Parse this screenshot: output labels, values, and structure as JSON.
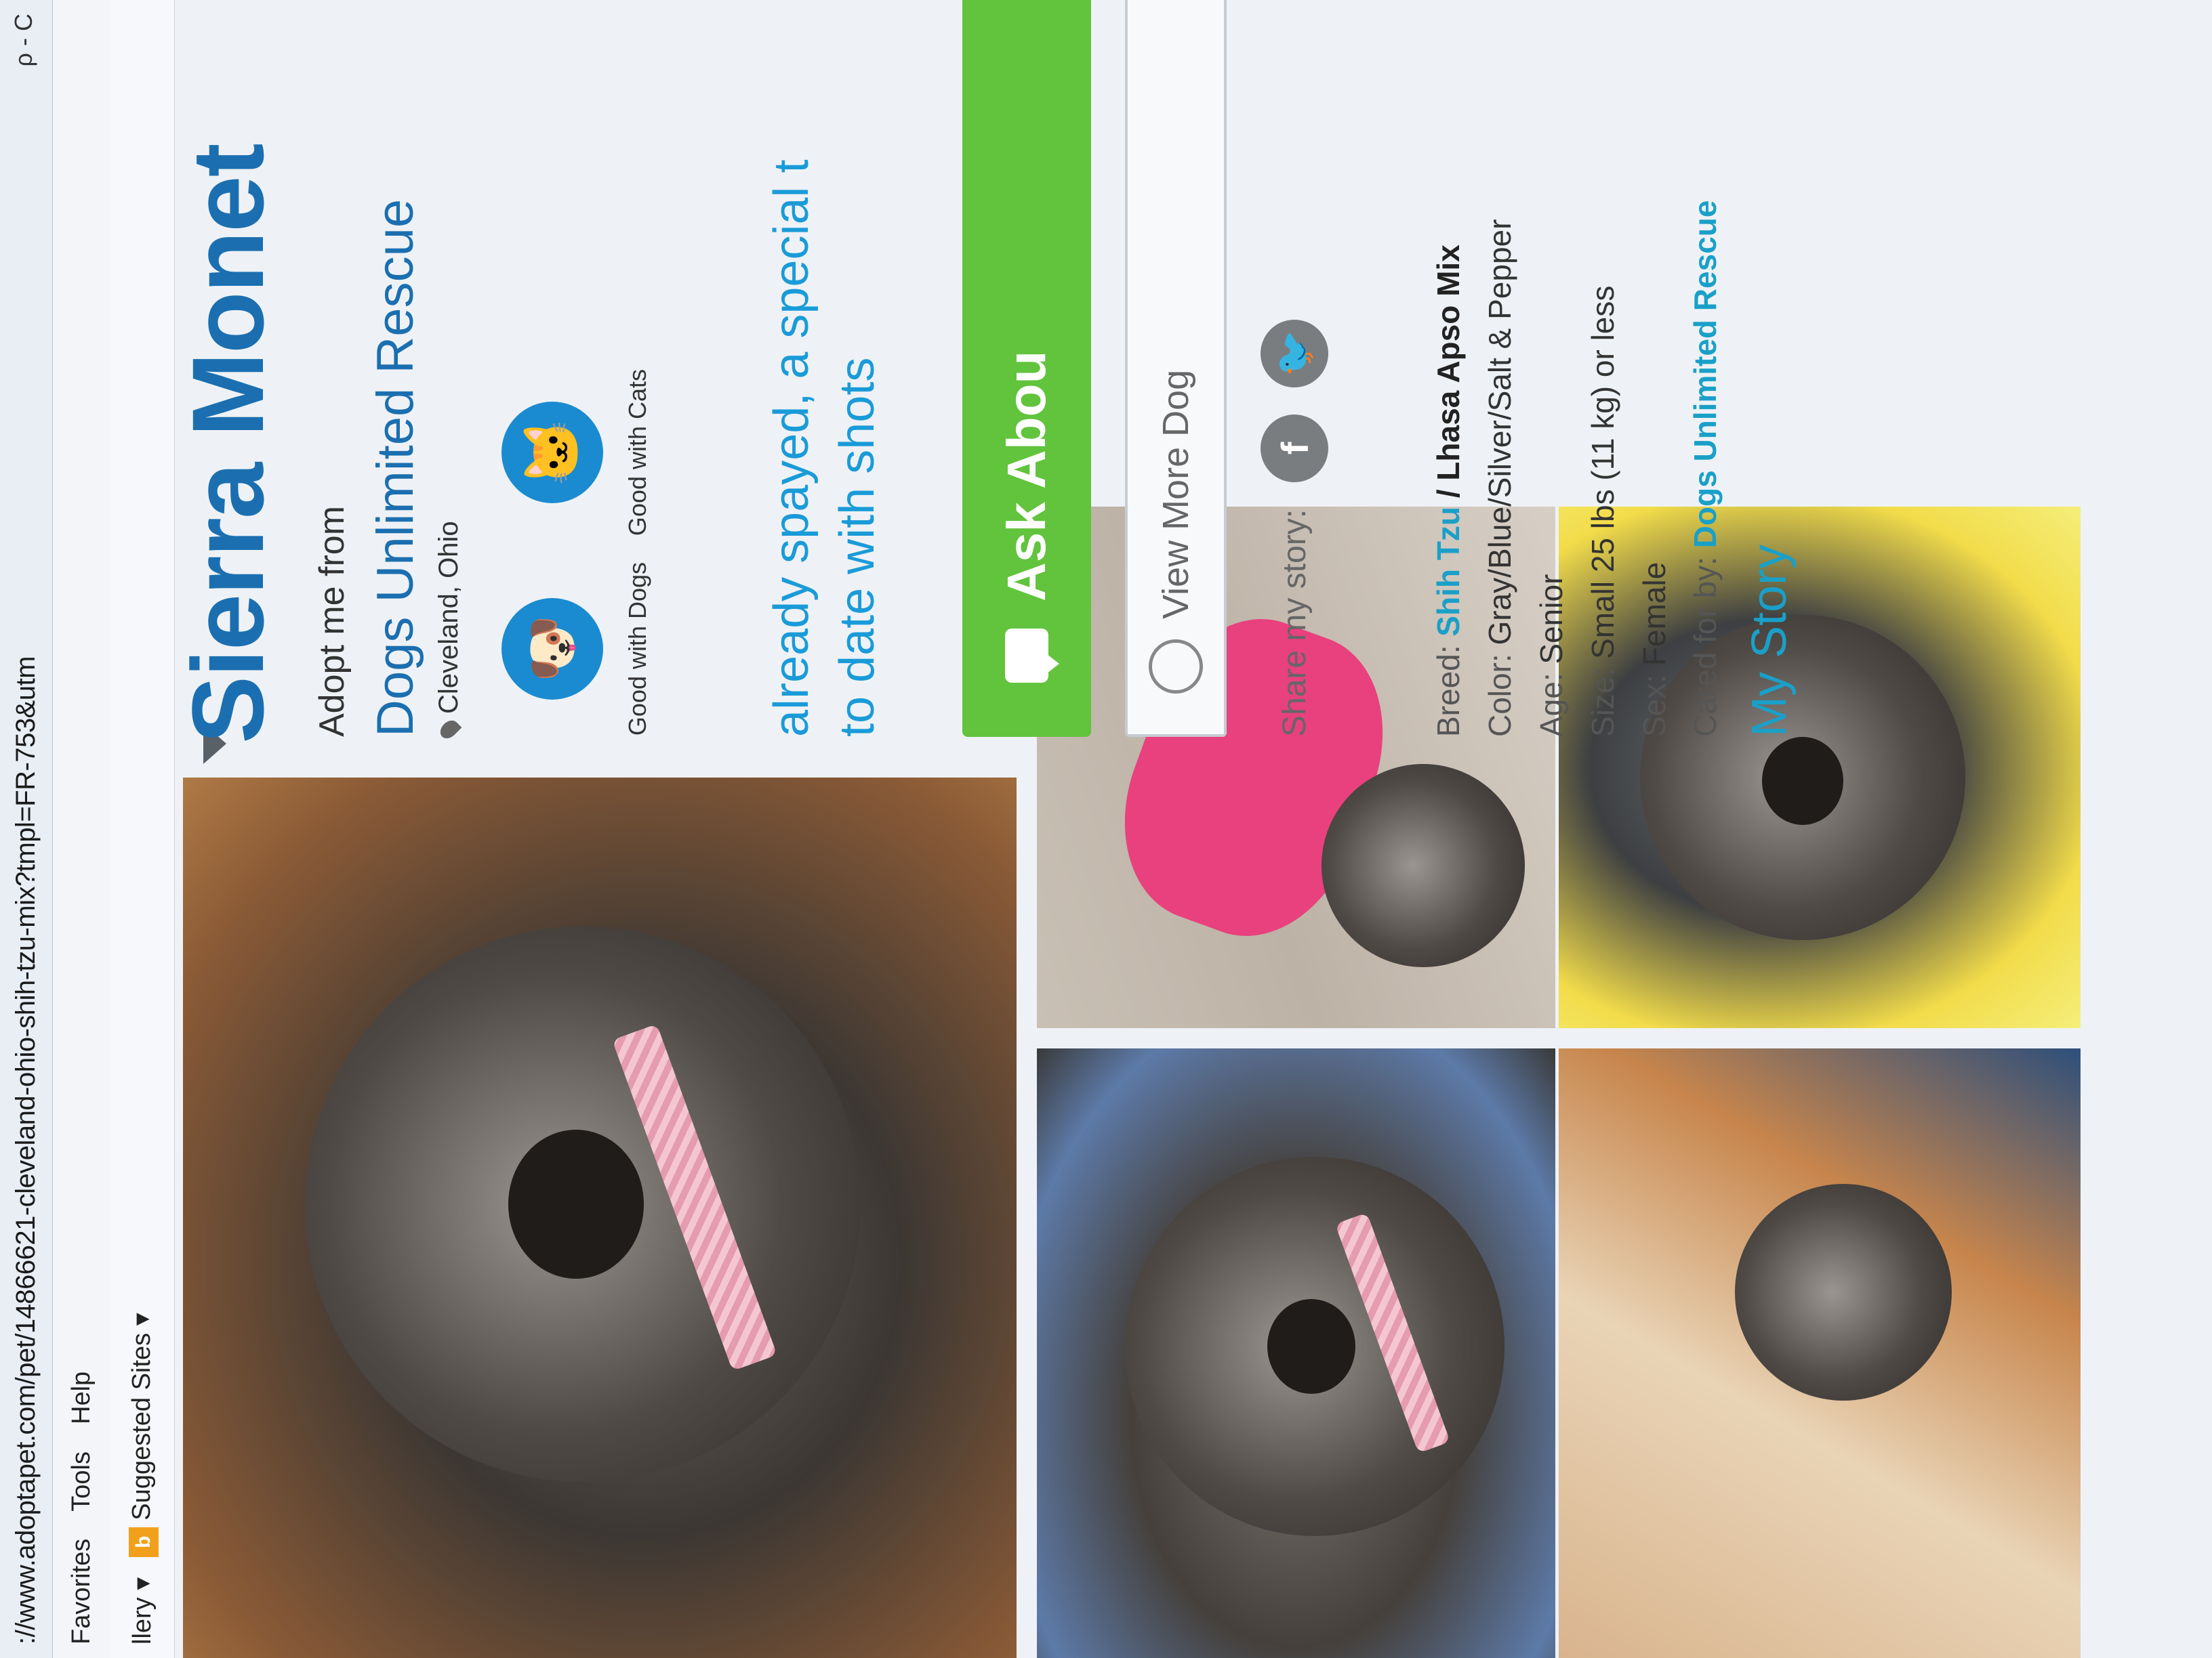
{
  "browser": {
    "url": "://www.adoptapet.com/pet/14866621-cleveland-ohio-shih-tzu-mix?tmpl=FR-753&utm",
    "right_text": "ρ - C",
    "menu": [
      "Favorites",
      "Tools",
      "Help"
    ],
    "fav_items": [
      "llery ▾",
      "Suggested Sites ▾"
    ]
  },
  "pet": {
    "name": "Sierra Monet",
    "adopt_from_label": "Adopt me from",
    "rescue": "Dogs Unlimited Rescue",
    "location": "Cleveland, Ohio",
    "badges": [
      {
        "label": "Good with Dogs",
        "icon": "dog-icon"
      },
      {
        "label": "Good with Cats",
        "icon": "cat-icon"
      }
    ],
    "blurb_line1": "already spayed, a special t",
    "blurb_line2": "to date with shots",
    "ask_label": "Ask Abou",
    "view_more_label": "View More Dog",
    "share_label": "Share my story:",
    "facts": {
      "breed_label": "Breed:",
      "breed_primary": "Shih Tzu",
      "breed_secondary": "/ Lhasa Apso Mix",
      "color_label": "Color:",
      "color_value": "Gray/Blue/Silver/Salt & Pepper",
      "age_label": "Age:",
      "age_value": "Senior",
      "size_label": "Size:",
      "size_value": "Small 25 lbs (11 kg) or less",
      "sex_label": "Sex:",
      "sex_value": "Female",
      "cared_label": "Cared for by:",
      "cared_value": "Dogs Unlimited Rescue"
    },
    "my_story": "My Story"
  }
}
